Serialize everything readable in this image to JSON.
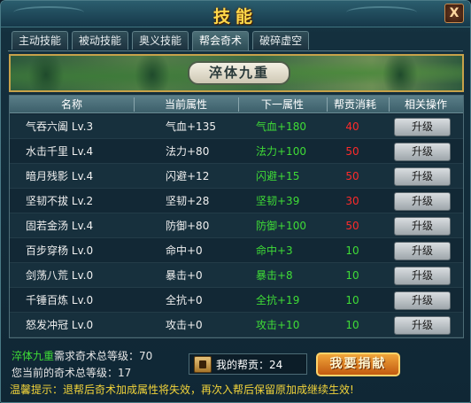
{
  "window": {
    "title": "技能",
    "close_label": "X"
  },
  "tabs": [
    {
      "label": "主动技能",
      "active": false
    },
    {
      "label": "被动技能",
      "active": false
    },
    {
      "label": "奥义技能",
      "active": false
    },
    {
      "label": "帮会奇术",
      "active": true
    },
    {
      "label": "破碎虚空",
      "active": false
    }
  ],
  "banner": {
    "title": "淬体九重"
  },
  "table": {
    "headers": [
      "名称",
      "当前属性",
      "下一属性",
      "帮贡消耗",
      "相关操作"
    ],
    "upgrade_label": "升级",
    "rows": [
      {
        "name": "气吞六阖 Lv.3",
        "current": "气血+135",
        "next": "气血+180",
        "cost": "40",
        "cost_color": "red"
      },
      {
        "name": "水击千里 Lv.4",
        "current": "法力+80",
        "next": "法力+100",
        "cost": "50",
        "cost_color": "red"
      },
      {
        "name": "暗月残影 Lv.4",
        "current": "闪避+12",
        "next": "闪避+15",
        "cost": "50",
        "cost_color": "red"
      },
      {
        "name": "坚韧不拔 Lv.2",
        "current": "坚韧+28",
        "next": "坚韧+39",
        "cost": "30",
        "cost_color": "red"
      },
      {
        "name": "固若金汤 Lv.4",
        "current": "防御+80",
        "next": "防御+100",
        "cost": "50",
        "cost_color": "red"
      },
      {
        "name": "百步穿杨 Lv.0",
        "current": "命中+0",
        "next": "命中+3",
        "cost": "10",
        "cost_color": "green"
      },
      {
        "name": "剑荡八荒 Lv.0",
        "current": "暴击+0",
        "next": "暴击+8",
        "cost": "10",
        "cost_color": "green"
      },
      {
        "name": "千锤百炼 Lv.0",
        "current": "全抗+0",
        "next": "全抗+19",
        "cost": "10",
        "cost_color": "green"
      },
      {
        "name": "怒发冲冠 Lv.0",
        "current": "攻击+0",
        "next": "攻击+10",
        "cost": "10",
        "cost_color": "green"
      }
    ]
  },
  "footer": {
    "req_name": "淬体九重",
    "req_text": "需求奇术总等级：70",
    "current_text": "您当前的奇术总等级：17",
    "tip_text": "温馨提示：退帮后奇术加成属性将失效，再次入帮后保留原加成继续生效!",
    "contrib_label": "我的帮贡：",
    "contrib_value": "24",
    "donate_label": "我要捐献"
  },
  "colors": {
    "gain_green": "#3fdc36",
    "cost_red": "#ff2a2a",
    "tip_yellow": "#f2d43a",
    "title_gold": "#ffd84a"
  }
}
